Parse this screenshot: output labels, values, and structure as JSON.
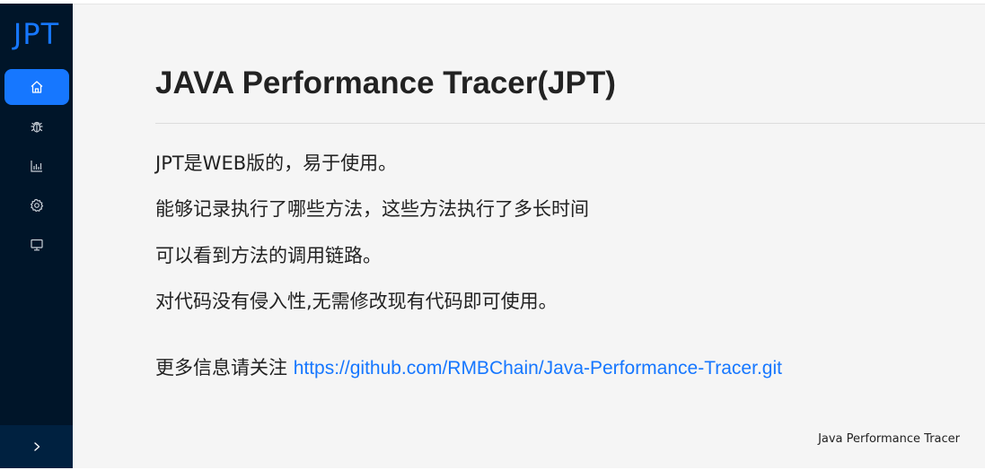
{
  "sidebar": {
    "logo": "JPT",
    "menu": [
      {
        "icon": "home-icon",
        "active": true
      },
      {
        "icon": "bug-icon",
        "active": false
      },
      {
        "icon": "bar-chart-icon",
        "active": false
      },
      {
        "icon": "gear-icon",
        "active": false
      },
      {
        "icon": "desktop-icon",
        "active": false
      }
    ],
    "collapse_icon": "chevron-right-icon"
  },
  "colors": {
    "sidebar_bg": "#001529",
    "accent": "#1677ff",
    "content_bg": "#f5f5f5"
  },
  "main": {
    "title": "JAVA Performance Tracer(JPT)",
    "paragraphs": [
      "JPT是WEB版的，易于使用。",
      "能够记录执行了哪些方法，这些方法执行了多长时间",
      "可以看到方法的调用链路。",
      "对代码没有侵入性,无需修改现有代码即可使用。"
    ],
    "more_info_prefix": "更多信息请关注 ",
    "more_info_link": "https://github.com/RMBChain/Java-Performance-Tracer.git"
  },
  "footer": {
    "text": "Java Performance Tracer"
  }
}
